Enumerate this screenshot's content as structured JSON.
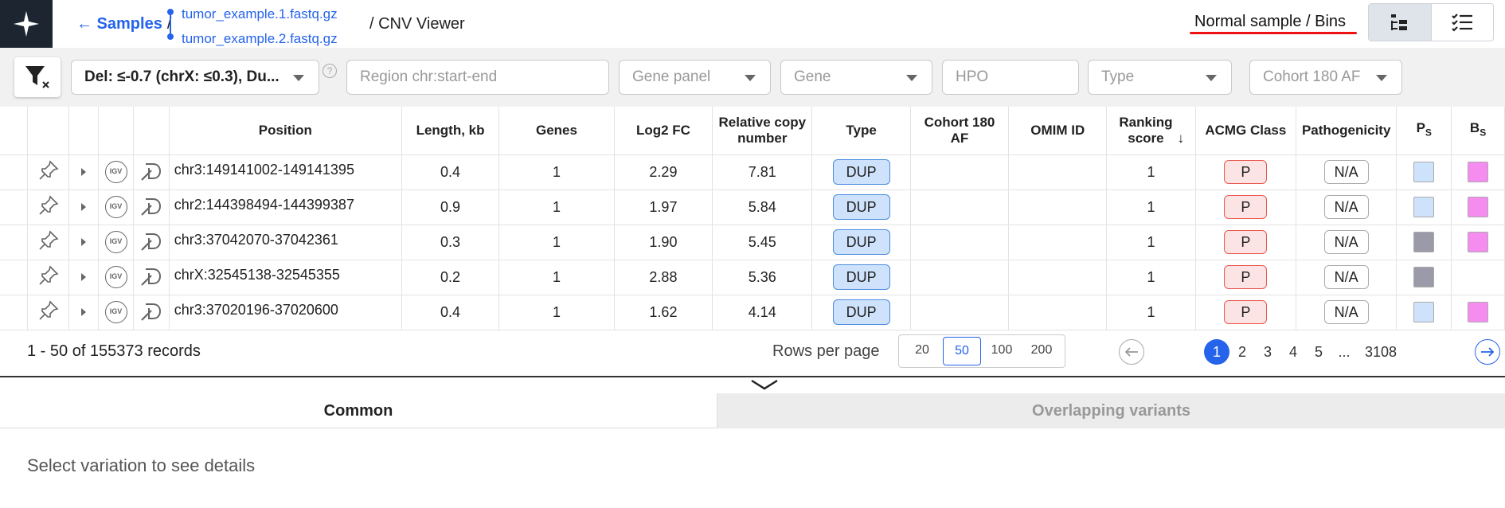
{
  "header": {
    "back_label": "← Samples",
    "sep": "/",
    "files": [
      "tumor_example.1.fastq.gz",
      "tumor_example.2.fastq.gz"
    ],
    "page_suffix": "/ CNV Viewer",
    "sample_title": "Normal sample / Bins"
  },
  "filters": {
    "deletion_filter": "Del: ≤-0.7 (chrX: ≤0.3), Du...",
    "region_placeholder": "Region chr:start-end",
    "gene_panel": "Gene panel",
    "gene": "Gene",
    "hpo": "HPO",
    "type": "Type",
    "cohort": "Cohort 180 AF",
    "help": "?"
  },
  "table": {
    "columns": [
      "Position",
      "Length, kb",
      "Genes",
      "Log2 FC",
      "Relative copy number",
      "Type",
      "Cohort 180 AF",
      "OMIM ID",
      "Ranking score",
      "ACMG Class",
      "Pathogenicity",
      "PS",
      "BS"
    ],
    "sort_arrow": "↓",
    "igv_label": "IGV",
    "rows": [
      {
        "position": "chr3:149141002-149141395",
        "length": "0.4",
        "genes": "1",
        "log2fc": "2.29",
        "rcn": "7.81",
        "type": "DUP",
        "cohort": "",
        "omim": "",
        "rank": "1",
        "acmg": "P",
        "path": "N/A",
        "ps_color": "#cfe2fb",
        "bs_color": "#f58cf0"
      },
      {
        "position": "chr2:144398494-144399387",
        "length": "0.9",
        "genes": "1",
        "log2fc": "1.97",
        "rcn": "5.84",
        "type": "DUP",
        "cohort": "",
        "omim": "",
        "rank": "1",
        "acmg": "P",
        "path": "N/A",
        "ps_color": "#cfe2fb",
        "bs_color": "#f58cf0"
      },
      {
        "position": "chr3:37042070-37042361",
        "length": "0.3",
        "genes": "1",
        "log2fc": "1.90",
        "rcn": "5.45",
        "type": "DUP",
        "cohort": "",
        "omim": "",
        "rank": "1",
        "acmg": "P",
        "path": "N/A",
        "ps_color": "#9a9aa8",
        "bs_color": "#f58cf0"
      },
      {
        "position": "chrX:32545138-32545355",
        "length": "0.2",
        "genes": "1",
        "log2fc": "2.88",
        "rcn": "5.36",
        "type": "DUP",
        "cohort": "",
        "omim": "",
        "rank": "1",
        "acmg": "P",
        "path": "N/A",
        "ps_color": "#9a9aa8",
        "bs_color": ""
      },
      {
        "position": "chr3:37020196-37020600",
        "length": "0.4",
        "genes": "1",
        "log2fc": "1.62",
        "rcn": "4.14",
        "type": "DUP",
        "cohort": "",
        "omim": "",
        "rank": "1",
        "acmg": "P",
        "path": "N/A",
        "ps_color": "#cfe2fb",
        "bs_color": "#f58cf0"
      }
    ]
  },
  "pagination": {
    "records": "1 - 50 of 155373 records",
    "rows_per_page_label": "Rows per page",
    "rows_options": [
      "20",
      "50",
      "100",
      "200"
    ],
    "rows_selected": "50",
    "pages": [
      "1",
      "2",
      "3",
      "4",
      "5",
      "...",
      "3108"
    ],
    "current_page": "1"
  },
  "tabs": [
    "Common",
    "Overlapping variants"
  ],
  "details_text": "Select variation to see details"
}
